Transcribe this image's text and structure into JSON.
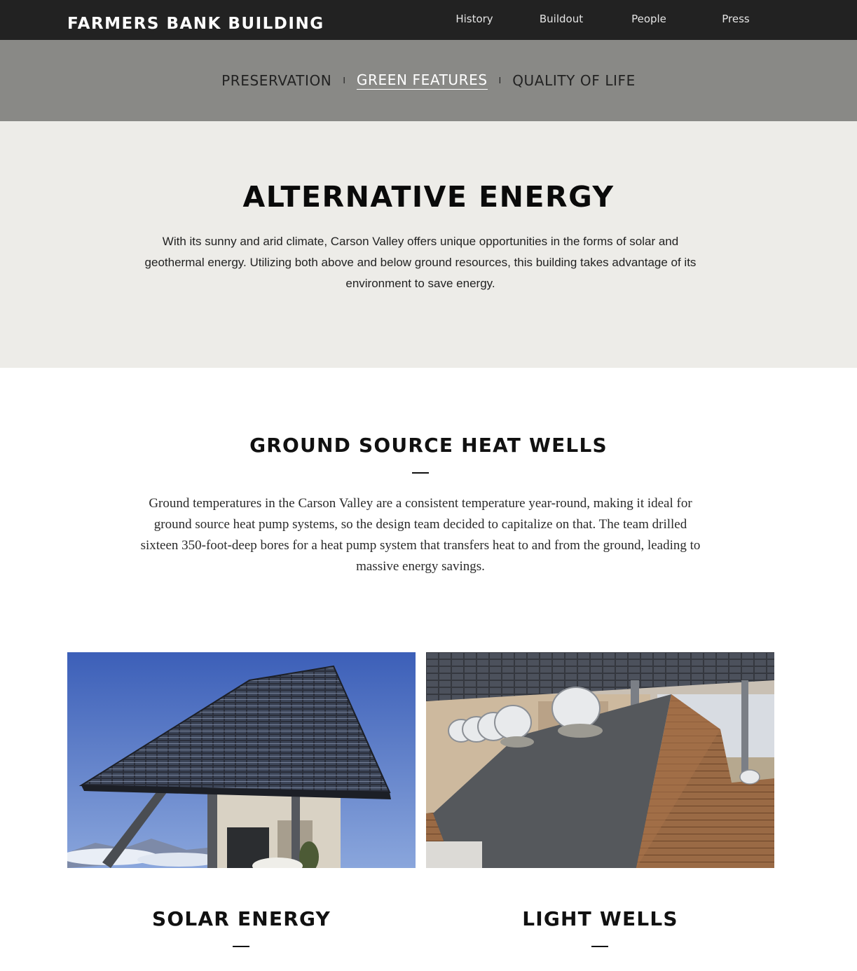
{
  "header": {
    "brand": "FARMERS BANK BUILDING",
    "nav": [
      "History",
      "Buildout",
      "People",
      "Press"
    ]
  },
  "subnav": {
    "items": [
      "PRESERVATION",
      "GREEN FEATURES",
      "QUALITY OF LIFE"
    ],
    "separator": "I",
    "active": "GREEN FEATURES"
  },
  "intro": {
    "title": "ALTERNATIVE ENERGY",
    "body": "With its sunny and arid climate, Carson Valley offers unique opportunities in the forms of solar and geothermal energy. Utilizing both above and below ground resources, this building takes advantage of its environment to save energy."
  },
  "heat_wells": {
    "title": "GROUND SOURCE HEAT WELLS",
    "body": "Ground temperatures in the Carson Valley are a consistent temperature year-round, making it ideal for ground source heat pump systems, so the design team decided to capitalize on that. The team drilled sixteen 350-foot-deep bores for a heat pump system that transfers heat to and from the ground, leading to massive energy savings."
  },
  "cards": [
    {
      "title": "SOLAR ENERGY",
      "image": "solar-canopy-photo"
    },
    {
      "title": "LIGHT WELLS",
      "image": "light-wells-photo"
    }
  ],
  "colors": {
    "topbar": "#222222",
    "subnav": "#898986",
    "intro_band": "#edece8",
    "sky": "#4a6dc0"
  }
}
